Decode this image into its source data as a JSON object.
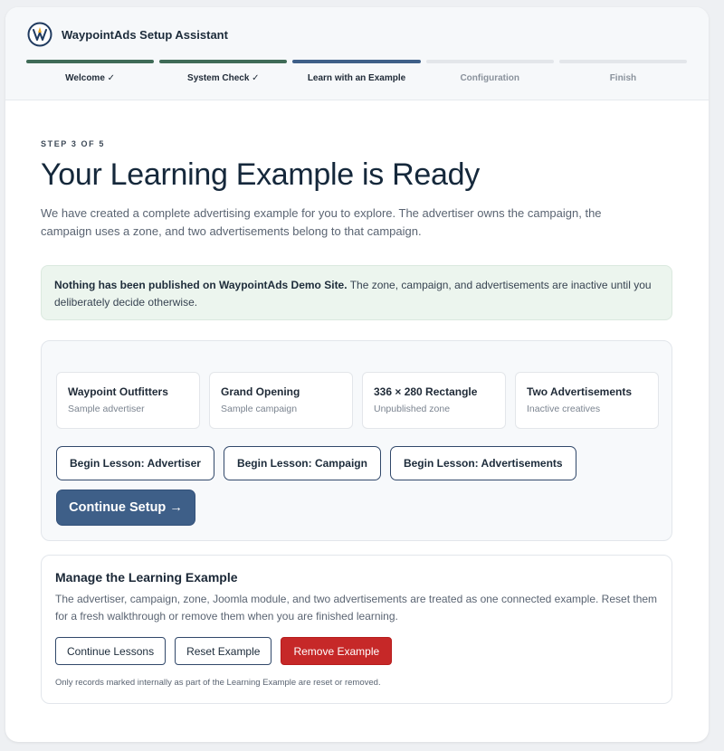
{
  "header": {
    "brand_name": "WaypointAds Setup Assistant",
    "logo_icon": "waypoint-logo-icon"
  },
  "steps": [
    {
      "label": "Welcome ✓",
      "state": "done"
    },
    {
      "label": "System Check ✓",
      "state": "done"
    },
    {
      "label": "Learn with an Example",
      "state": "current"
    },
    {
      "label": "Configuration",
      "state": "todo"
    },
    {
      "label": "Finish",
      "state": "todo"
    }
  ],
  "main": {
    "eyebrow": "STEP 3 OF 5",
    "title": "Your Learning Example is Ready",
    "intro": "We have created a complete advertising example for you to explore. The advertiser owns the campaign, the campaign uses a zone, and two advertisements belong to that campaign."
  },
  "notice": {
    "strong": "Nothing has been published on WaypointAds Demo Site.",
    "text": " The zone, campaign, and advertisements are inactive until you deliberately decide otherwise."
  },
  "example": {
    "tiles": [
      {
        "title": "Waypoint Outfitters",
        "sub": "Sample advertiser"
      },
      {
        "title": "Grand Opening",
        "sub": "Sample campaign"
      },
      {
        "title": "336 × 280 Rectangle",
        "sub": "Unpublished zone"
      },
      {
        "title": "Two Advertisements",
        "sub": "Inactive creatives"
      }
    ],
    "lessons": [
      {
        "label": "Begin Lesson: Advertiser"
      },
      {
        "label": "Begin Lesson: Campaign"
      },
      {
        "label": "Begin Lesson: Advertisements"
      }
    ],
    "continue_label": "Continue Setup →"
  },
  "manage": {
    "title": "Manage the Learning Example",
    "desc": "The advertiser, campaign, zone, Joomla module, and two advertisements are treated as one connected example. Reset them for a fresh walkthrough or remove them when you are finished learning.",
    "continue_label": "Continue Lessons",
    "reset_label": "Reset Example",
    "remove_label": "Remove Example",
    "note": "Only records marked internally as part of the Learning Example are reset or removed."
  },
  "colors": {
    "accent": "#3e5f88",
    "done": "#3f6b57",
    "danger": "#c62828",
    "notice_bg": "#ecf5ee"
  }
}
